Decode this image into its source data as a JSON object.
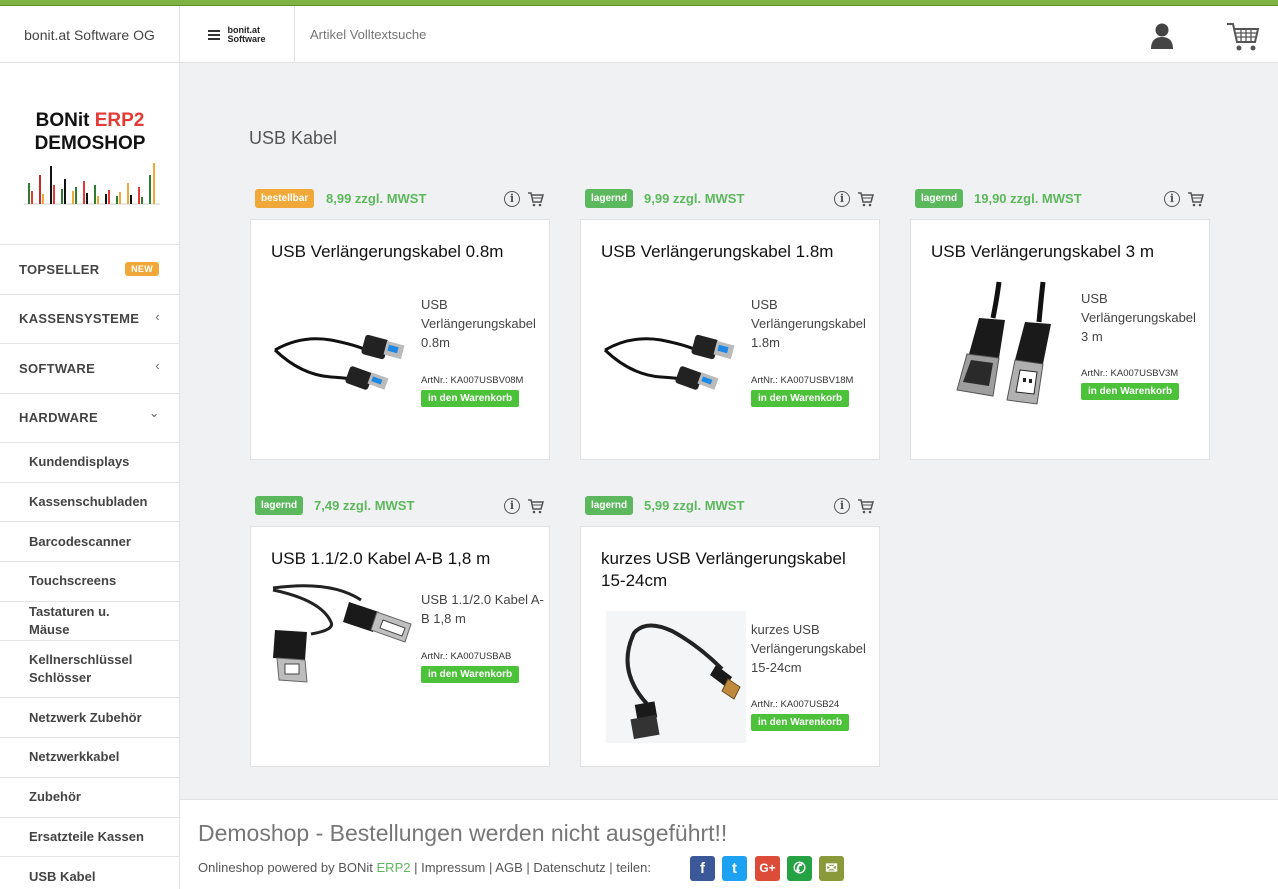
{
  "header": {
    "company": "bonit.at Software OG",
    "brand_line1": "bonit.at",
    "brand_line2": "Software",
    "search_placeholder": "Artikel Volltextsuche"
  },
  "sidebar": {
    "logo_line1": "BONit",
    "logo_erp": "ERP2",
    "logo_line2": "DEMOSHOP",
    "nav": [
      {
        "label": "TOPSELLER",
        "badge": "NEW"
      },
      {
        "label": "KASSENSYSTEME",
        "chevron": "‹"
      },
      {
        "label": "SOFTWARE",
        "chevron": "‹"
      },
      {
        "label": "HARDWARE",
        "chevron": "⌄"
      }
    ],
    "subitems": [
      "Kundendisplays",
      "Kassenschubladen",
      "Barcodescanner",
      "Touchscreens",
      "Tastaturen u. Mäuse",
      "Kellnerschlüssel Schlösser",
      "Netzwerk Zubehör",
      "Netzwerkkabel",
      "Zubehör",
      "Ersatzteile Kassen",
      "USB Kabel"
    ]
  },
  "main": {
    "title": "USB Kabel",
    "add_label": "in den Warenkorb",
    "products": [
      {
        "stock": "bestellbar",
        "price": "8,99 zzgl. MWST",
        "name": "USB Verlängerungskabel 0.8m",
        "desc": "USB Verlängerungskabel 0.8m",
        "artnr": "ArtNr.: KA007USBV08M"
      },
      {
        "stock": "lagernd",
        "price": "9,99 zzgl. MWST",
        "name": "USB Verlängerungskabel 1.8m",
        "desc": "USB Verlängerungskabel 1.8m",
        "artnr": "ArtNr.: KA007USBV18M"
      },
      {
        "stock": "lagernd",
        "price": "19,90 zzgl. MWST",
        "name": "USB Verlängerungskabel 3 m",
        "desc": "USB Verlängerungskabel 3 m",
        "artnr": "ArtNr.: KA007USBV3M"
      },
      {
        "stock": "lagernd",
        "price": "7,49 zzgl. MWST",
        "name": "USB 1.1/2.0 Kabel A-B 1,8 m",
        "desc": "USB 1.1/2.0 Kabel A-B 1,8 m",
        "artnr": "ArtNr.: KA007USBAB"
      },
      {
        "stock": "lagernd",
        "price": "5,99 zzgl. MWST",
        "name": "kurzes USB Verlängerungskabel 15-24cm",
        "desc": "kurzes USB Verlängerungskabel 15-24cm",
        "artnr": "ArtNr.: KA007USB24"
      }
    ]
  },
  "footer": {
    "title": "Demoshop - Bestellungen werden nicht ausgeführt!!",
    "powered": "Onlineshop powered by",
    "bonit": "BONit",
    "erp": "ERP2",
    "impressum": "Impressum",
    "agb": "AGB",
    "datenschutz": "Datenschutz",
    "teilen": "teilen:",
    "share": [
      {
        "icon": "facebook-icon",
        "glyph": "f",
        "color": "#3b5998"
      },
      {
        "icon": "twitter-icon",
        "glyph": "t",
        "color": "#1da1f2"
      },
      {
        "icon": "google-plus-icon",
        "glyph": "G+",
        "color": "#dd4b39"
      },
      {
        "icon": "whatsapp-icon",
        "glyph": "✆",
        "color": "#25a244"
      },
      {
        "icon": "email-icon",
        "glyph": "✉",
        "color": "#8a9a3a"
      }
    ]
  }
}
